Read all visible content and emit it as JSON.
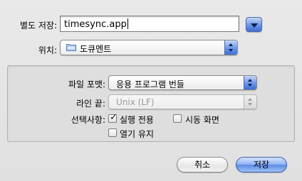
{
  "save_as": {
    "label": "별도 저장:",
    "filename": "timesync.app"
  },
  "where": {
    "label": "위치:",
    "folder": "도큐멘트"
  },
  "options": {
    "file_format": {
      "label": "파일 포맷:",
      "value": "응용 프로그램 번들"
    },
    "line_endings": {
      "label": "라인 끝:",
      "value": "Unix (LF)"
    },
    "options_label": "선택사항:",
    "run_only": {
      "label": "실행 전용",
      "checked": true
    },
    "startup_screen": {
      "label": "시동 화면",
      "checked": false
    },
    "stay_open": {
      "label": "열기 유지",
      "checked": false
    }
  },
  "buttons": {
    "cancel": "취소",
    "save": "저장"
  },
  "icons": [
    "chevron-down-icon",
    "folder-icon",
    "popup-arrows-icon",
    "checkmark-icon"
  ]
}
